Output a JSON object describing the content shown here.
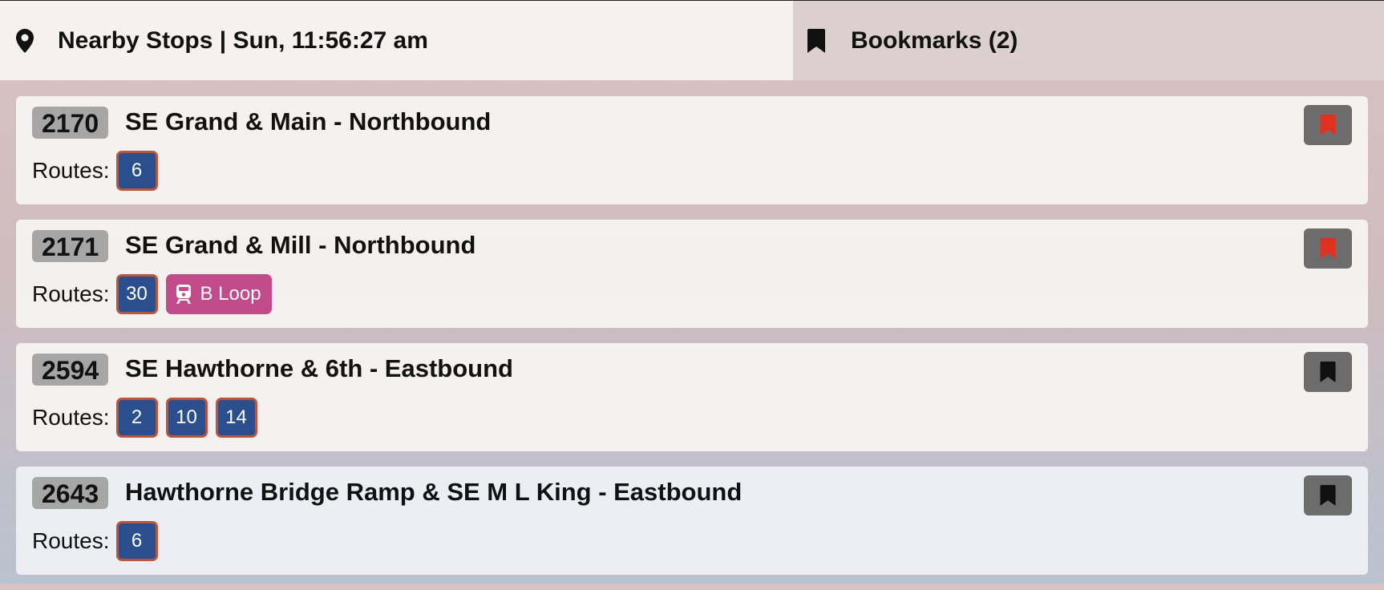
{
  "tabs": {
    "nearby_label": "Nearby Stops | Sun, 11:56:27 am",
    "bookmarks_label": "Bookmarks (2)"
  },
  "colors": {
    "route_pill": "#2b4f8e",
    "route_border": "#b8553d",
    "streetcar_pill": "#c24b8c",
    "bookmarked": "#e03020",
    "not_bookmarked": "#111111"
  },
  "stops": [
    {
      "id": "2170",
      "name": "SE Grand & Main - Northbound",
      "routes_label": "Routes:",
      "routes": [
        "6"
      ],
      "special_routes": [],
      "bookmarked": true
    },
    {
      "id": "2171",
      "name": "SE Grand & Mill - Northbound",
      "routes_label": "Routes:",
      "routes": [
        "30"
      ],
      "special_routes": [
        {
          "label": "B Loop",
          "icon": "streetcar-icon"
        }
      ],
      "bookmarked": true
    },
    {
      "id": "2594",
      "name": "SE Hawthorne & 6th - Eastbound",
      "routes_label": "Routes:",
      "routes": [
        "2",
        "10",
        "14"
      ],
      "special_routes": [],
      "bookmarked": false
    },
    {
      "id": "2643",
      "name": "Hawthorne Bridge Ramp & SE M L King - Eastbound",
      "routes_label": "Routes:",
      "routes": [
        "6"
      ],
      "special_routes": [],
      "bookmarked": false
    }
  ]
}
